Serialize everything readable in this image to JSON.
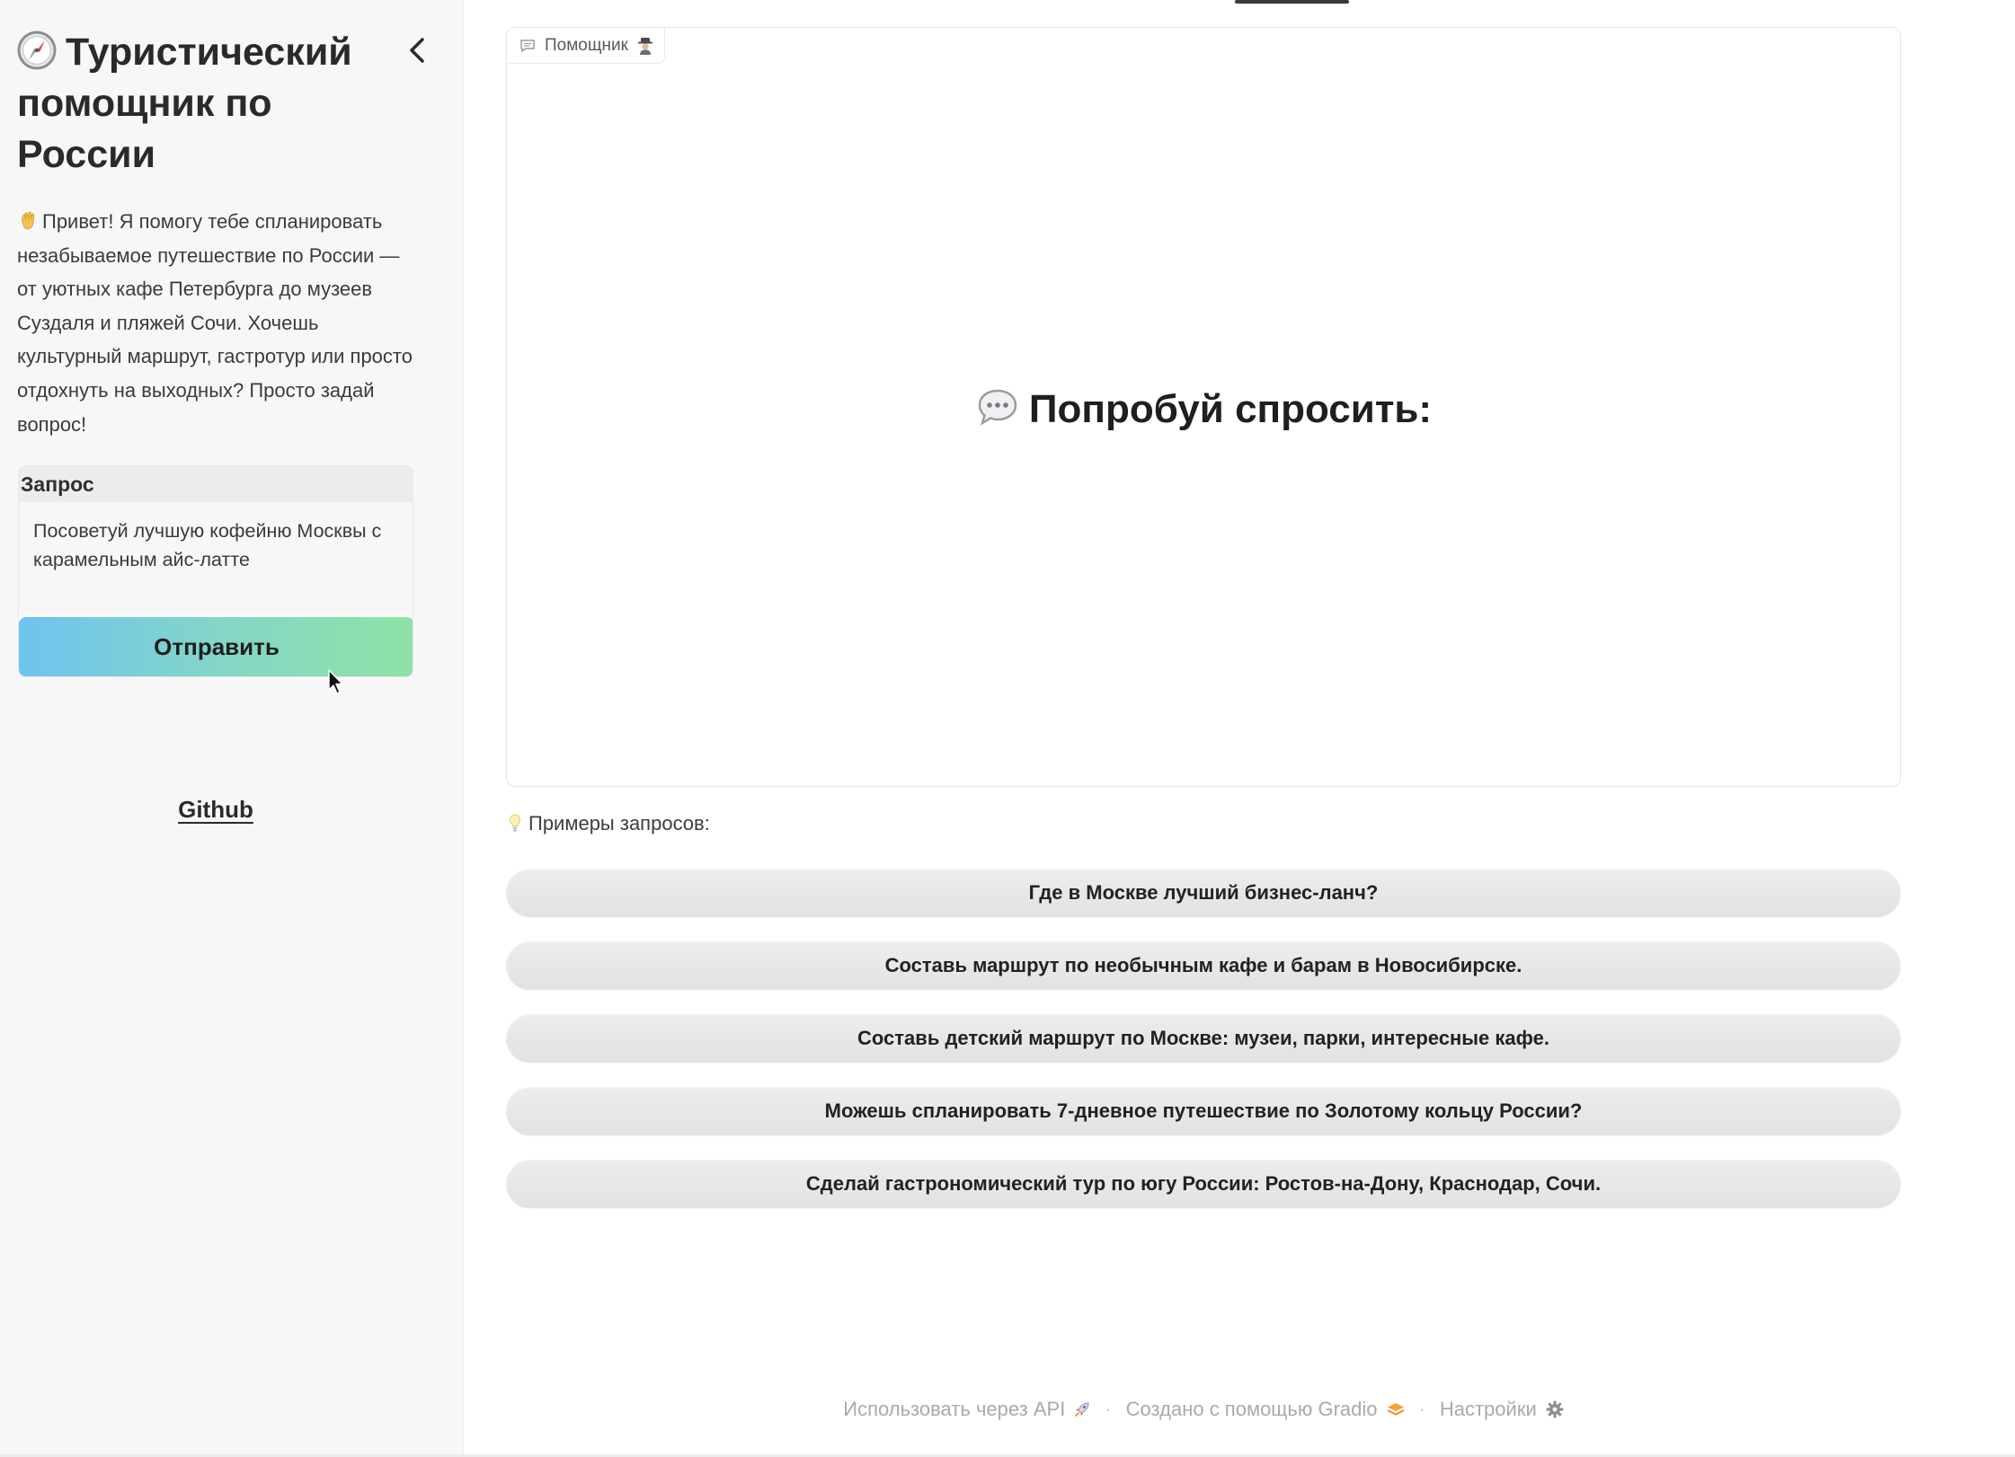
{
  "sidebar": {
    "title": "Туристический помощник по России",
    "title_icon": "compass-icon",
    "collapse_icon": "chevron-left-icon",
    "intro": "Привет! Я помогу тебе спланировать незабываемое путешествие по России — от уютных кафе Петербурга до музеев Суздаля и пляжей Сочи. Хочешь культурный маршрут, гастротур или просто отдохнуть на выходных? Просто задай вопрос!",
    "intro_icon": "waving-hand-icon",
    "query": {
      "label": "Запрос",
      "value": "Посоветуй лучшую кофейню Москвы с карамельным айс-латте"
    },
    "send_label": "Отправить",
    "github_label": "Github"
  },
  "chat": {
    "tab_label": "Помощник",
    "tab_icons": [
      "chat-bubble-icon",
      "detective-icon"
    ],
    "placeholder": "Попробуй спросить:",
    "placeholder_icon": "speech-bubble-icon"
  },
  "examples": {
    "label": "Примеры запросов:",
    "label_icon": "lightbulb-icon",
    "items": [
      "Где в Москве лучший бизнес-ланч?",
      "Составь маршрут по необычным кафе и барам в Новосибирске.",
      "Составь детский маршрут по Москве: музеи, парки, интересные кафе.",
      "Можешь спланировать 7-дневное путешествие по Золотому кольцу России?",
      "Сделай гастрономический тур по югу России: Ростов-на-Дону, Краснодар, Сочи."
    ]
  },
  "footer": {
    "api": "Использовать через API",
    "gradio": "Создано с помощью Gradio",
    "settings": "Настройки",
    "separator": "·"
  },
  "colors": {
    "send_gradient_start": "#6ec3f0",
    "send_gradient_end": "#8ee3a4",
    "sidebar_bg": "#f7f7f8",
    "footer_text": "#a9a9ae"
  }
}
